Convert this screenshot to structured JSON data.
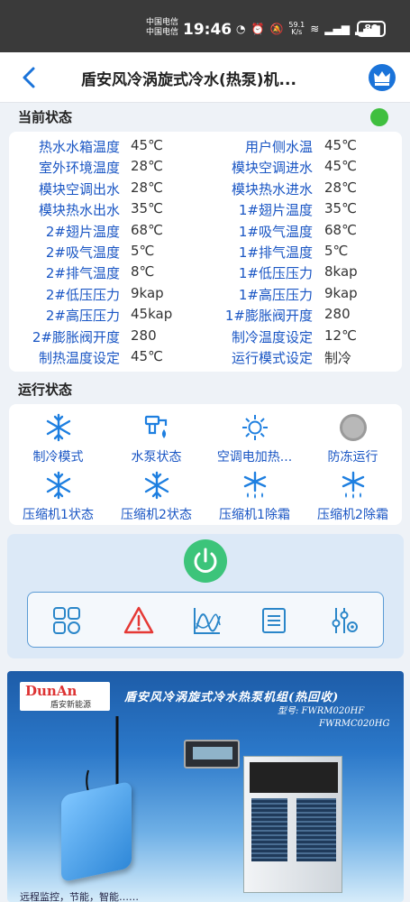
{
  "statusbar": {
    "carrier1": "中国电信",
    "carrier2": "中国电信",
    "time": "19:46",
    "net_speed_value": "59.1",
    "net_speed_unit": "K/s",
    "battery": "80"
  },
  "header": {
    "title": "盾安风冷涡旋式冷水(热泵)机..."
  },
  "current_status": {
    "section_title": "当前状态",
    "online_color": "#3fbf3f",
    "rows": [
      {
        "left_label": "热水水箱温度",
        "left_value": "45℃",
        "right_label": "用户侧水温",
        "right_value": "45℃"
      },
      {
        "left_label": "室外环境温度",
        "left_value": "28℃",
        "right_label": "模块空调进水",
        "right_value": "45℃"
      },
      {
        "left_label": "模块空调出水",
        "left_value": "28℃",
        "right_label": "模块热水进水",
        "right_value": "28℃"
      },
      {
        "left_label": "模块热水出水",
        "left_value": "35℃",
        "right_label": "1#翅片温度",
        "right_value": "35℃"
      },
      {
        "left_label": "2#翅片温度",
        "left_value": "68℃",
        "right_label": "1#吸气温度",
        "right_value": "68℃"
      },
      {
        "left_label": "2#吸气温度",
        "left_value": "5℃",
        "right_label": "1#排气温度",
        "right_value": "5℃"
      },
      {
        "left_label": "2#排气温度",
        "left_value": "8℃",
        "right_label": "1#低压压力",
        "right_value": "8kap"
      },
      {
        "left_label": "2#低压压力",
        "left_value": "9kap",
        "right_label": "1#高压压力",
        "right_value": "9kap"
      },
      {
        "left_label": "2#高压压力",
        "left_value": "45kap",
        "right_label": "1#膨胀阀开度",
        "right_value": "280"
      },
      {
        "left_label": "2#膨胀阀开度",
        "left_value": "280",
        "right_label": "制冷温度设定",
        "right_value": "12℃"
      },
      {
        "left_label": "制热温度设定",
        "left_value": "45℃",
        "right_label": "运行模式设定",
        "right_value": "制冷"
      }
    ]
  },
  "run_status": {
    "section_title": "运行状态",
    "items": [
      {
        "label": "制冷模式",
        "icon": "snowflake-icon"
      },
      {
        "label": "水泵状态",
        "icon": "water-pump-icon"
      },
      {
        "label": "空调电加热...",
        "icon": "sun-icon"
      },
      {
        "label": "防冻运行",
        "icon": "antifreeze-icon"
      },
      {
        "label": "压缩机1状态",
        "icon": "snowflake-icon"
      },
      {
        "label": "压缩机2状态",
        "icon": "snowflake-icon"
      },
      {
        "label": "压缩机1除霜",
        "icon": "defrost-icon"
      },
      {
        "label": "压缩机2除霜",
        "icon": "defrost-icon"
      }
    ]
  },
  "colors": {
    "accent": "#1a73d9",
    "label_blue": "#1a56c4",
    "power_green": "#3cc47a",
    "alarm_red": "#e53935"
  },
  "banner": {
    "brand_en": "DunAn",
    "brand_cn": "盾安新能源",
    "title": "盾安风冷涡旋式冷水热泵机组(热回收)",
    "model_label": "型号: FWRM020HF",
    "model_2": "FWRMC020HG",
    "bottom_text": "远程监控，节能，智能……"
  }
}
